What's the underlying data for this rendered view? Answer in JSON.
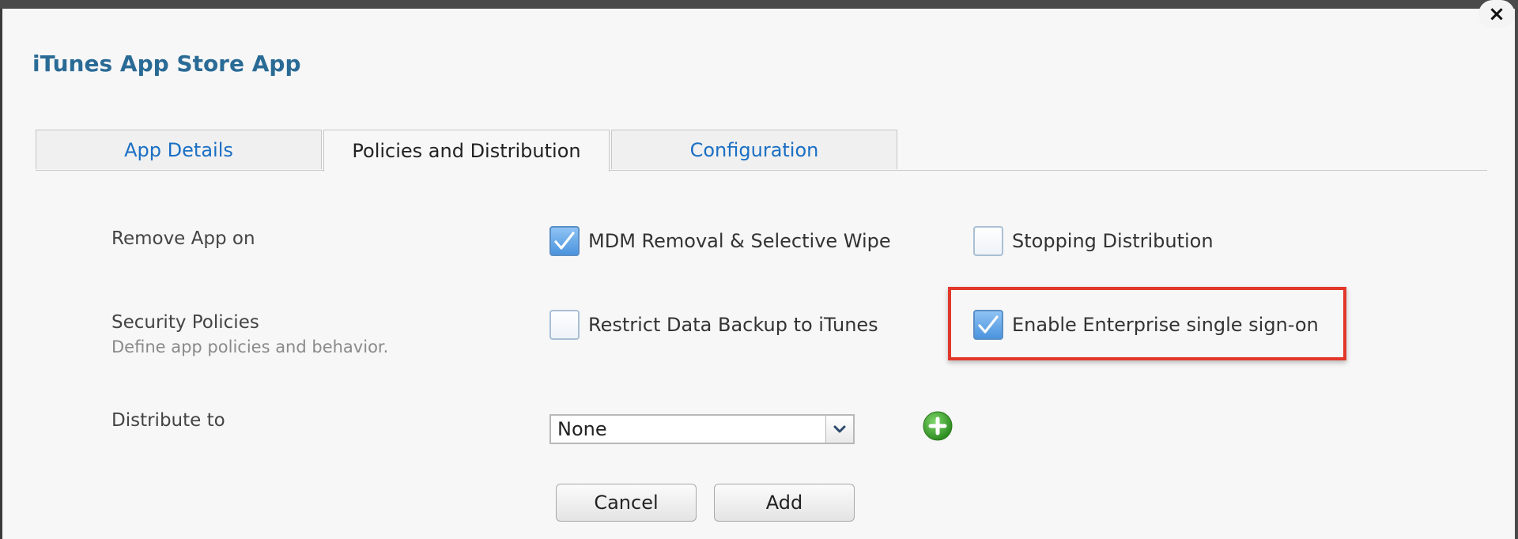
{
  "dialog": {
    "title": "iTunes App Store App",
    "close_glyph": "×"
  },
  "tabs": [
    {
      "label": "App Details",
      "active": false
    },
    {
      "label": "Policies and Distribution",
      "active": true
    },
    {
      "label": "Configuration",
      "active": false
    }
  ],
  "remove_app": {
    "label": "Remove App on",
    "options": [
      {
        "label": "MDM Removal & Selective Wipe",
        "checked": true
      },
      {
        "label": "Stopping Distribution",
        "checked": false
      }
    ]
  },
  "security": {
    "label": "Security Policies",
    "description": "Define app policies and behavior.",
    "options": [
      {
        "label": "Restrict Data Backup to iTunes",
        "checked": false
      },
      {
        "label": "Enable Enterprise single sign-on",
        "checked": true
      }
    ]
  },
  "distribute": {
    "label": "Distribute to",
    "selected": "None"
  },
  "buttons": {
    "cancel": "Cancel",
    "add": "Add"
  },
  "colors": {
    "title": "#2a6b96",
    "tab_link": "#1a6fc4",
    "highlight": "#e2372a",
    "add_icon": "#3fa52e"
  },
  "icons": {
    "close": "close-icon",
    "checkmark": "checkmark-icon",
    "dropdown": "chevron-down-icon",
    "add": "plus-circle-icon"
  }
}
